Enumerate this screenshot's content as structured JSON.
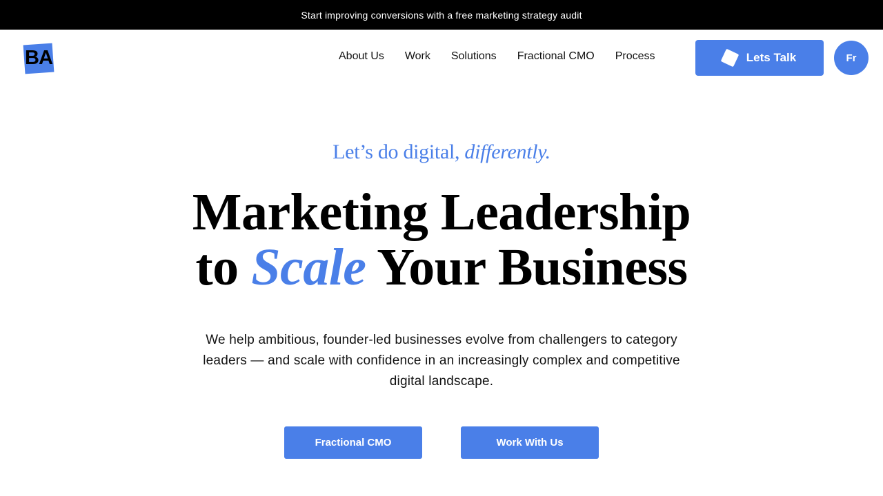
{
  "announcement": {
    "text": "Start improving conversions with a free marketing strategy audit"
  },
  "header": {
    "logo_text": "BA",
    "nav": [
      {
        "label": "About Us"
      },
      {
        "label": "Work"
      },
      {
        "label": "Solutions"
      },
      {
        "label": "Fractional CMO"
      },
      {
        "label": "Process"
      }
    ],
    "cta_label": "Lets Talk",
    "cta_icon": "diamond-icon",
    "language_label": "Fr"
  },
  "hero": {
    "eyebrow_main": "Let’s do digital, ",
    "eyebrow_italic": "differently.",
    "headline_line1": "Marketing Leadership",
    "headline_to": "to ",
    "headline_accent": "Scale",
    "headline_rest": " Your Business",
    "subtext": "We help ambitious, founder-led businesses evolve from challengers to category leaders — and scale with confidence in an increasingly complex and competitive digital landscape.",
    "buttons": [
      {
        "label": "Fractional CMO"
      },
      {
        "label": "Work With Us"
      }
    ]
  },
  "colors": {
    "accent": "#4a7fe8",
    "topbar_bg": "#000000",
    "text": "#111111"
  }
}
